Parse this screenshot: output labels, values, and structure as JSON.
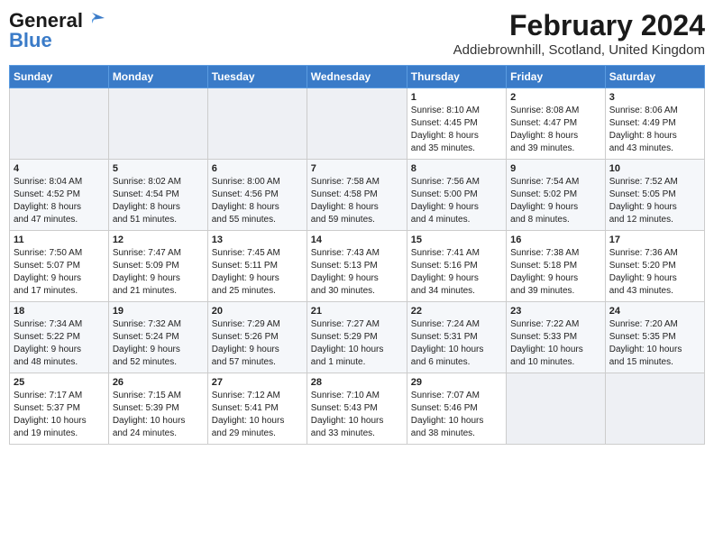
{
  "header": {
    "logo_line1": "General",
    "logo_line2": "Blue",
    "month_year": "February 2024",
    "location": "Addiebrownhill, Scotland, United Kingdom"
  },
  "weekdays": [
    "Sunday",
    "Monday",
    "Tuesday",
    "Wednesday",
    "Thursday",
    "Friday",
    "Saturday"
  ],
  "weeks": [
    [
      {
        "day": "",
        "info": ""
      },
      {
        "day": "",
        "info": ""
      },
      {
        "day": "",
        "info": ""
      },
      {
        "day": "",
        "info": ""
      },
      {
        "day": "1",
        "info": "Sunrise: 8:10 AM\nSunset: 4:45 PM\nDaylight: 8 hours\nand 35 minutes."
      },
      {
        "day": "2",
        "info": "Sunrise: 8:08 AM\nSunset: 4:47 PM\nDaylight: 8 hours\nand 39 minutes."
      },
      {
        "day": "3",
        "info": "Sunrise: 8:06 AM\nSunset: 4:49 PM\nDaylight: 8 hours\nand 43 minutes."
      }
    ],
    [
      {
        "day": "4",
        "info": "Sunrise: 8:04 AM\nSunset: 4:52 PM\nDaylight: 8 hours\nand 47 minutes."
      },
      {
        "day": "5",
        "info": "Sunrise: 8:02 AM\nSunset: 4:54 PM\nDaylight: 8 hours\nand 51 minutes."
      },
      {
        "day": "6",
        "info": "Sunrise: 8:00 AM\nSunset: 4:56 PM\nDaylight: 8 hours\nand 55 minutes."
      },
      {
        "day": "7",
        "info": "Sunrise: 7:58 AM\nSunset: 4:58 PM\nDaylight: 8 hours\nand 59 minutes."
      },
      {
        "day": "8",
        "info": "Sunrise: 7:56 AM\nSunset: 5:00 PM\nDaylight: 9 hours\nand 4 minutes."
      },
      {
        "day": "9",
        "info": "Sunrise: 7:54 AM\nSunset: 5:02 PM\nDaylight: 9 hours\nand 8 minutes."
      },
      {
        "day": "10",
        "info": "Sunrise: 7:52 AM\nSunset: 5:05 PM\nDaylight: 9 hours\nand 12 minutes."
      }
    ],
    [
      {
        "day": "11",
        "info": "Sunrise: 7:50 AM\nSunset: 5:07 PM\nDaylight: 9 hours\nand 17 minutes."
      },
      {
        "day": "12",
        "info": "Sunrise: 7:47 AM\nSunset: 5:09 PM\nDaylight: 9 hours\nand 21 minutes."
      },
      {
        "day": "13",
        "info": "Sunrise: 7:45 AM\nSunset: 5:11 PM\nDaylight: 9 hours\nand 25 minutes."
      },
      {
        "day": "14",
        "info": "Sunrise: 7:43 AM\nSunset: 5:13 PM\nDaylight: 9 hours\nand 30 minutes."
      },
      {
        "day": "15",
        "info": "Sunrise: 7:41 AM\nSunset: 5:16 PM\nDaylight: 9 hours\nand 34 minutes."
      },
      {
        "day": "16",
        "info": "Sunrise: 7:38 AM\nSunset: 5:18 PM\nDaylight: 9 hours\nand 39 minutes."
      },
      {
        "day": "17",
        "info": "Sunrise: 7:36 AM\nSunset: 5:20 PM\nDaylight: 9 hours\nand 43 minutes."
      }
    ],
    [
      {
        "day": "18",
        "info": "Sunrise: 7:34 AM\nSunset: 5:22 PM\nDaylight: 9 hours\nand 48 minutes."
      },
      {
        "day": "19",
        "info": "Sunrise: 7:32 AM\nSunset: 5:24 PM\nDaylight: 9 hours\nand 52 minutes."
      },
      {
        "day": "20",
        "info": "Sunrise: 7:29 AM\nSunset: 5:26 PM\nDaylight: 9 hours\nand 57 minutes."
      },
      {
        "day": "21",
        "info": "Sunrise: 7:27 AM\nSunset: 5:29 PM\nDaylight: 10 hours\nand 1 minute."
      },
      {
        "day": "22",
        "info": "Sunrise: 7:24 AM\nSunset: 5:31 PM\nDaylight: 10 hours\nand 6 minutes."
      },
      {
        "day": "23",
        "info": "Sunrise: 7:22 AM\nSunset: 5:33 PM\nDaylight: 10 hours\nand 10 minutes."
      },
      {
        "day": "24",
        "info": "Sunrise: 7:20 AM\nSunset: 5:35 PM\nDaylight: 10 hours\nand 15 minutes."
      }
    ],
    [
      {
        "day": "25",
        "info": "Sunrise: 7:17 AM\nSunset: 5:37 PM\nDaylight: 10 hours\nand 19 minutes."
      },
      {
        "day": "26",
        "info": "Sunrise: 7:15 AM\nSunset: 5:39 PM\nDaylight: 10 hours\nand 24 minutes."
      },
      {
        "day": "27",
        "info": "Sunrise: 7:12 AM\nSunset: 5:41 PM\nDaylight: 10 hours\nand 29 minutes."
      },
      {
        "day": "28",
        "info": "Sunrise: 7:10 AM\nSunset: 5:43 PM\nDaylight: 10 hours\nand 33 minutes."
      },
      {
        "day": "29",
        "info": "Sunrise: 7:07 AM\nSunset: 5:46 PM\nDaylight: 10 hours\nand 38 minutes."
      },
      {
        "day": "",
        "info": ""
      },
      {
        "day": "",
        "info": ""
      }
    ]
  ]
}
